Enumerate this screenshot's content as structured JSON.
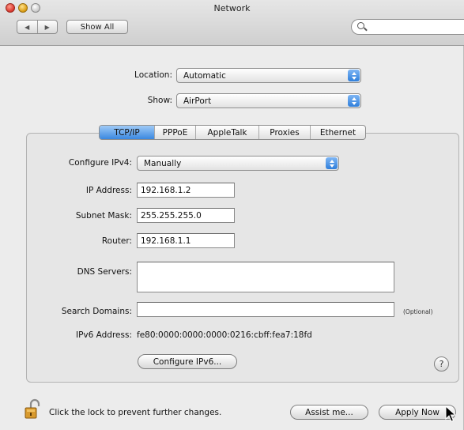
{
  "window": {
    "title": "Network"
  },
  "toolbar": {
    "back_glyph": "◀",
    "forward_glyph": "▶",
    "show_all_label": "Show All",
    "search_value": "",
    "search_placeholder": ""
  },
  "location": {
    "label": "Location:",
    "value": "Automatic"
  },
  "show": {
    "label": "Show:",
    "value": "AirPort"
  },
  "tabs": [
    {
      "label": "TCP/IP",
      "selected": true
    },
    {
      "label": "PPPoE",
      "selected": false
    },
    {
      "label": "AppleTalk",
      "selected": false
    },
    {
      "label": "Proxies",
      "selected": false
    },
    {
      "label": "Ethernet",
      "selected": false
    }
  ],
  "tcpip": {
    "configure_label": "Configure IPv4:",
    "configure_value": "Manually",
    "ip_label": "IP Address:",
    "ip_value": "192.168.1.2",
    "subnet_label": "Subnet Mask:",
    "subnet_value": "255.255.255.0",
    "router_label": "Router:",
    "router_value": "192.168.1.1",
    "dns_label": "DNS Servers:",
    "dns_value": "",
    "search_label": "Search Domains:",
    "search_value": "",
    "optional_text": "(Optional)",
    "ipv6_label": "IPv6 Address:",
    "ipv6_value": "fe80:0000:0000:0000:0216:cbff:fea7:18fd",
    "configure_ipv6_label": "Configure IPv6...",
    "help_glyph": "?"
  },
  "footer": {
    "lock_text": "Click the lock to prevent further changes.",
    "assist_label": "Assist me...",
    "apply_label": "Apply Now"
  },
  "colors": {
    "accent": "#3a88e0",
    "window_bg": "#ececec"
  },
  "icons": {
    "lock": "lock-icon",
    "search": "search-icon",
    "help": "help-icon"
  }
}
